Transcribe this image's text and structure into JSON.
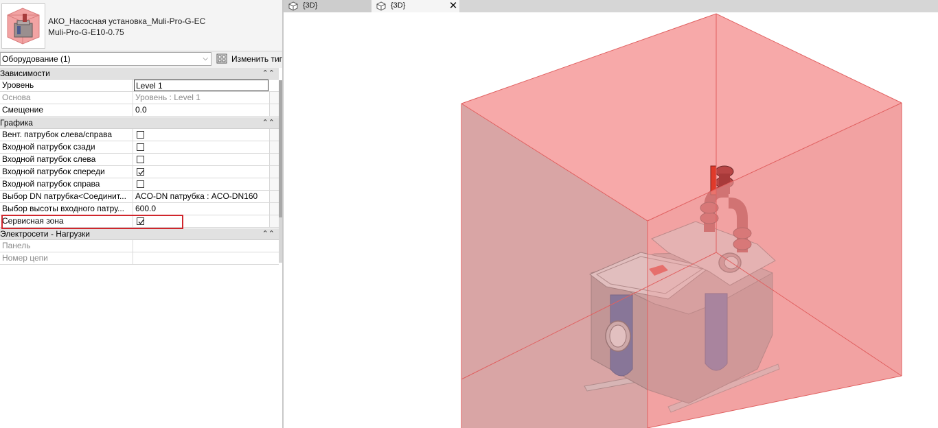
{
  "type_selector": {
    "family_name": "АКО_Насосная установка_Muli-Pro-G-EC",
    "type_name": "Muli-Pro-G-E10-0.75"
  },
  "instance_selector": {
    "selected": "Оборудование (1)",
    "edit_type_label": "Изменить тип"
  },
  "groups": [
    {
      "label": "Зависимости"
    },
    {
      "label": "Графика"
    },
    {
      "label": "Электросети - Нагрузки"
    }
  ],
  "rows": [
    {
      "label": "Уровень",
      "value": "Level 1",
      "dim": false
    },
    {
      "label": "Основа",
      "value": "Уровень : Level 1",
      "dim": true
    },
    {
      "label": "Смещение",
      "value": "0.0",
      "dim": false
    },
    {
      "label": "Вент. патрубок слева/справа",
      "checked": false
    },
    {
      "label": "Входной патрубок сзади",
      "checked": false
    },
    {
      "label": "Входной патрубок слева",
      "checked": false
    },
    {
      "label": "Входной патрубок спереди",
      "checked": true
    },
    {
      "label": "Входной патрубок справа",
      "checked": false
    },
    {
      "label": "Выбор DN патрубка<Соединит...",
      "value": "ACO-DN патрубка : ACO-DN160",
      "dim": false
    },
    {
      "label": "Выбор высоты входного патру...",
      "value": "600.0",
      "dim": false
    },
    {
      "label": "Сервисная зона",
      "checked": true
    },
    {
      "label": "Панель",
      "value": "",
      "dim": true
    },
    {
      "label": "Номер цепи",
      "value": "",
      "dim": true
    }
  ],
  "tabs": [
    {
      "label": "{3D}",
      "active": false
    },
    {
      "label": "{3D}",
      "active": true
    }
  ],
  "colors": {
    "service_zone": "#f08c8c",
    "pump_body": "#c9b9b9",
    "pipes": "#d24a4a",
    "handle": "#e03a2a",
    "window": "#51609a",
    "highlight": "#d0262c"
  }
}
